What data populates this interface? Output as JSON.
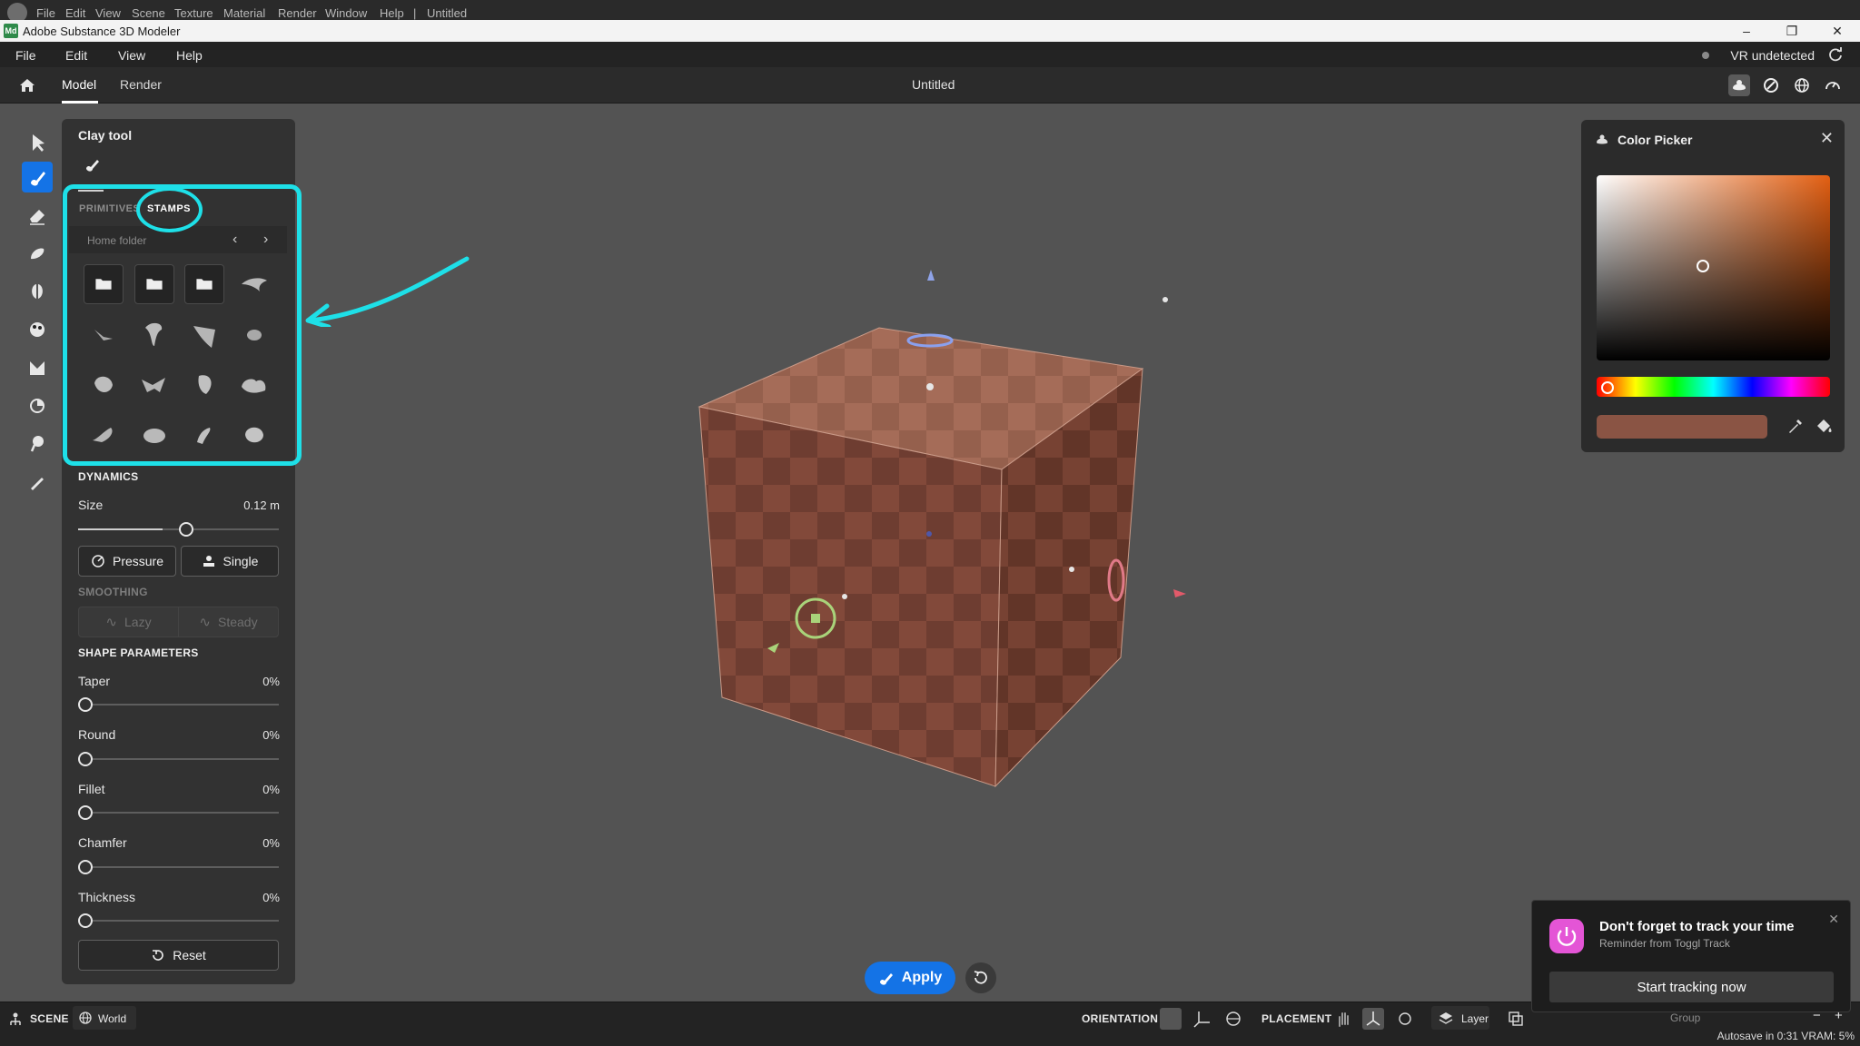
{
  "system_menu": {
    "items": [
      "File",
      "Edit",
      "View",
      "Scene",
      "Texture",
      "Material",
      "Render",
      "Window",
      "Help",
      "|",
      "Untitled"
    ]
  },
  "window": {
    "badge": "Md",
    "title": "Adobe Substance 3D Modeler",
    "buttons": [
      "–",
      "❐",
      "✕"
    ]
  },
  "menubar": {
    "items": [
      "File",
      "Edit",
      "View",
      "Help"
    ],
    "vr_status": "VR undetected"
  },
  "toolbar": {
    "tabs": [
      "Model",
      "Render"
    ],
    "active_tab": "Model",
    "document_title": "Untitled"
  },
  "left_rail": {
    "tools": [
      "select-arrow-icon",
      "clay-brush-icon",
      "eraser-icon",
      "smooth-icon",
      "mirror-icon",
      "paint-icon",
      "move-icon",
      "lasso-icon",
      "pin-icon",
      "pencil-icon"
    ],
    "selected": "clay-brush-icon"
  },
  "clay_panel": {
    "title": "Clay tool",
    "tabs": [
      "PRIMITIVES",
      "STAMPS"
    ],
    "active_tab": "STAMPS",
    "folder_label": "Home folder",
    "stamp_grid": [
      "folder",
      "folder",
      "folder",
      "stamp",
      "stamp",
      "stamp",
      "stamp",
      "stamp",
      "stamp",
      "stamp",
      "stamp",
      "stamp",
      "stamp",
      "stamp",
      "stamp",
      "stamp"
    ],
    "dynamics": {
      "heading": "DYNAMICS",
      "size_label": "Size",
      "size_value": "0.12 m",
      "size_fraction": 0.42,
      "pressure_label": "Pressure",
      "single_label": "Single"
    },
    "smoothing": {
      "heading": "SMOOTHING",
      "lazy_label": "Lazy",
      "steady_label": "Steady"
    },
    "shape_parameters": {
      "heading": "SHAPE PARAMETERS",
      "params": [
        {
          "label": "Taper",
          "value": "0%"
        },
        {
          "label": "Round",
          "value": "0%"
        },
        {
          "label": "Fillet",
          "value": "0%"
        },
        {
          "label": "Chamfer",
          "value": "0%"
        },
        {
          "label": "Thickness",
          "value": "0%"
        }
      ]
    },
    "reset_label": "Reset"
  },
  "color_picker": {
    "title": "Color Picker",
    "hue_color": "#e35f12",
    "current_color": "#8a5444"
  },
  "actions": {
    "apply_label": "Apply"
  },
  "bottom_bar": {
    "scene_label": "SCENE",
    "world_label": "World",
    "orientation_label": "ORIENTATION",
    "placement_label": "PLACEMENT",
    "layer_label": "Layer",
    "group_label": "Group",
    "autosave_text": "Autosave in 0:31  VRAM: 5%"
  },
  "toast": {
    "title": "Don't forget to track your time",
    "subtitle": "Reminder from Toggl Track",
    "button_label": "Start tracking now"
  },
  "colors": {
    "accent": "#1473e6",
    "annotation": "#1ee0e8",
    "cube_light": "#8d5645",
    "cube_dark": "#6f3e31"
  }
}
